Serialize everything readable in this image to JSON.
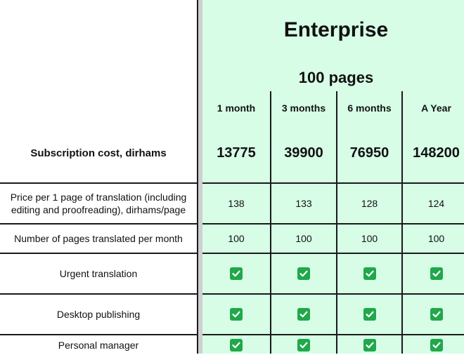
{
  "plan": {
    "name": "Enterprise",
    "pages": "100 pages"
  },
  "periods": [
    "1 month",
    "3 months",
    "6 months",
    "A Year"
  ],
  "subscription": {
    "label": "Subscription cost, dirhams",
    "values": [
      "13775",
      "39900",
      "76950",
      "148200"
    ]
  },
  "rows": [
    {
      "label": "Price per 1 page of translation (including editing and proofreading), dirhams/page",
      "values": [
        "138",
        "133",
        "128",
        "124"
      ]
    },
    {
      "label": "Number of pages translated per month",
      "values": [
        "100",
        "100",
        "100",
        "100"
      ]
    },
    {
      "label": "Urgent translation",
      "check": true
    },
    {
      "label": "Desktop publishing",
      "check": true
    },
    {
      "label": "Personal manager",
      "check": true
    }
  ],
  "colors": {
    "panel": "#d7fde7",
    "check": "#20a84a",
    "border": "#1a1a1a"
  },
  "icons": {
    "included": "check-icon"
  }
}
